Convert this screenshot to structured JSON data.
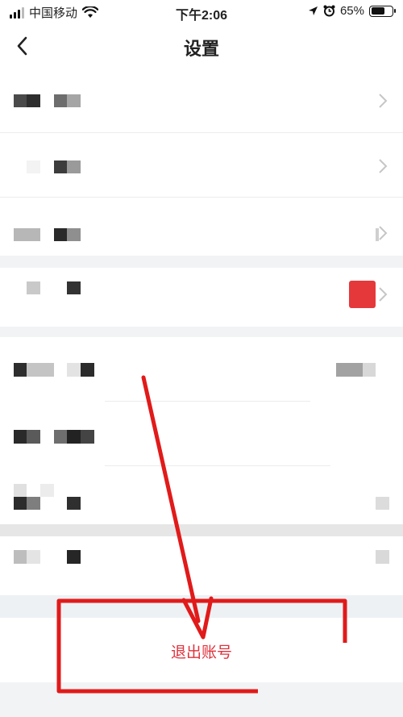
{
  "status_bar": {
    "carrier": "中国移动",
    "time": "下午2:06",
    "battery": "65%",
    "battery_level": 0.65,
    "icons": [
      "signal-icon",
      "wifi-icon",
      "location-icon",
      "alarm-icon",
      "battery-icon"
    ]
  },
  "nav": {
    "back_icon": "chevron-left-icon",
    "title": "设置"
  },
  "settings_rows_note_redacted": true,
  "logout": {
    "label": "退出账号",
    "color": "#e0323c"
  },
  "annotation": {
    "color": "#e11a1a"
  }
}
